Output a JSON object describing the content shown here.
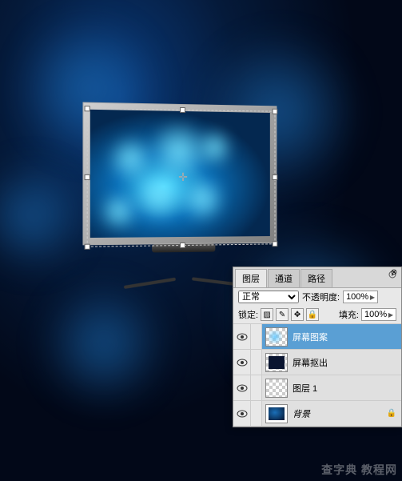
{
  "panel": {
    "tabs": {
      "layers": "图层",
      "channels": "通道",
      "paths": "路径"
    },
    "blend_mode": "正常",
    "opacity_label": "不透明度:",
    "opacity_value": "100%",
    "lock_label": "锁定:",
    "fill_label": "填充:",
    "fill_value": "100%"
  },
  "layers": [
    {
      "name": "屏幕图案",
      "selected": true,
      "visible": true,
      "thumb": "checker-glow"
    },
    {
      "name": "屏幕抠出",
      "selected": false,
      "visible": true,
      "thumb": "checker-dark"
    },
    {
      "name": "图层 1",
      "selected": false,
      "visible": true,
      "thumb": "checker"
    },
    {
      "name": "背景",
      "selected": false,
      "visible": true,
      "thumb": "bg",
      "locked": true,
      "italic": true
    }
  ],
  "watermark": {
    "main": "查字典 教程网"
  }
}
